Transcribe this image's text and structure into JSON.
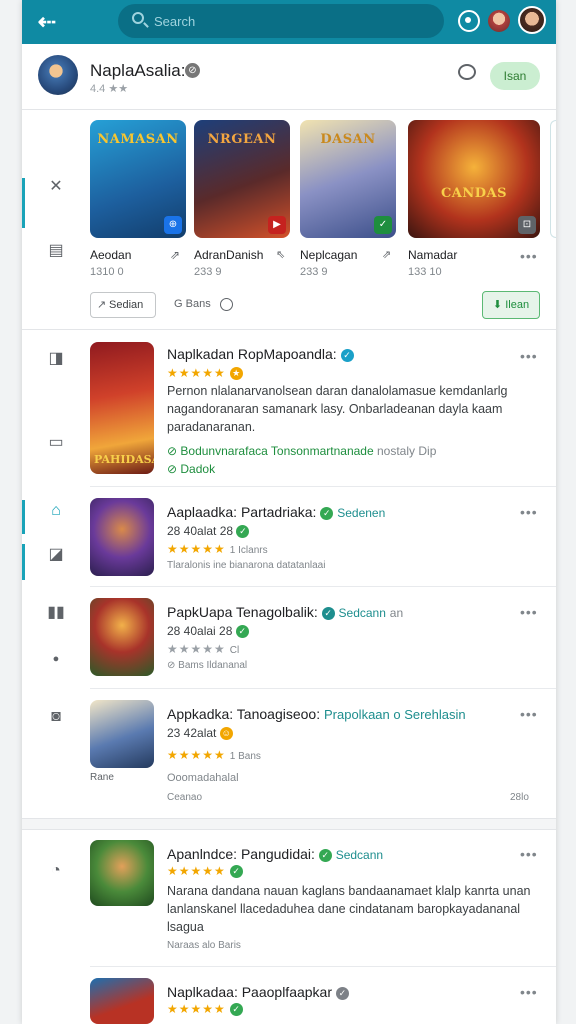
{
  "topbar": {
    "search_placeholder": "Search",
    "back_icon": "arrow-left-icon"
  },
  "header": {
    "title": "NaplaAsalia:",
    "rating": "4.4 ★★",
    "action_label": "Isan"
  },
  "featured": [
    {
      "name": "Aeodan",
      "size": "1310 0",
      "art": "NAMASAN",
      "bg": "#1d79b6",
      "badge": "#1a73e8"
    },
    {
      "name": "AdranDanish",
      "size": "233 9",
      "art": "NRGEAN",
      "bg": "#7a2a18",
      "badge": "#c5221f"
    },
    {
      "name": "Neplcagan",
      "size": "233 9",
      "art": "DASAN",
      "bg": "#6b7fb0",
      "badge": "#1e8e3e"
    },
    {
      "name": "Namadar",
      "size": "133 10",
      "art": "CANDAS",
      "bg": "#7d1f16",
      "badge": "#5f6368"
    }
  ],
  "controls": {
    "share_label": "Sedian",
    "gen_label": "Bans",
    "open_label": "Ilean"
  },
  "items": [
    {
      "title": "Naplkadan RopMapoandla:",
      "stars": "★★★★★",
      "desc": "Pernon nlalanarvanolsean daran danalolamasue kemdanlarlg nagandoranaran samanark lasy. Onbarladeanan dayla kaam paradanaranan.",
      "gline": "Bodunvnarafaca Tonsonmartnanade",
      "gline_gray": "nostaly Dip",
      "gline2": "Dadok",
      "art": "PAHIDASAN",
      "bg": "#b8242a"
    },
    {
      "title": "Aaplaadka: Partadriaka:",
      "tag": "Sedenen",
      "sub": "28 40alat 28",
      "stars": "★★★★★",
      "count": "1 Iclanrs",
      "meta": "Tlaralonis ine bianarona datatanlaai",
      "bg": "#5a3a8a"
    },
    {
      "title": "PapkUapa Tenagolbalik:",
      "tag": "Sedcann",
      "tag_gray": "an",
      "sub": "28 40alai 28",
      "stars": "★★★★★",
      "count": "Cl",
      "meta": "Bams Ildananal",
      "bg": "#2e6b2a"
    },
    {
      "title": "Appkadka: Tanoagiseoo:",
      "tag": "Prapolkaan o Serehlasin",
      "sub": "23 42alat",
      "stars": "★★★★★",
      "count": "1 Bans",
      "meta": "Ooomadahalal",
      "left_label": "Rane",
      "foot_left": "Ceanao",
      "foot_right": "28lo",
      "bg": "#3a4f7a"
    },
    {
      "title": "Apanlndce: Pangudidai:",
      "tag": "Sedcann",
      "stars": "★★★★★",
      "desc": "Narana dandana nauan kaglans bandaanamaet klalp kanrta unan lanlanskanel llacedaduhea dane cindatanam baropkayadananal lsagua",
      "meta": "Naraas alo Baris",
      "bg": "#2f6a2e"
    },
    {
      "title": "Naplkadaa: Paaoplfaapkar",
      "stars": "★★★★★",
      "bg": "#b83224"
    }
  ]
}
